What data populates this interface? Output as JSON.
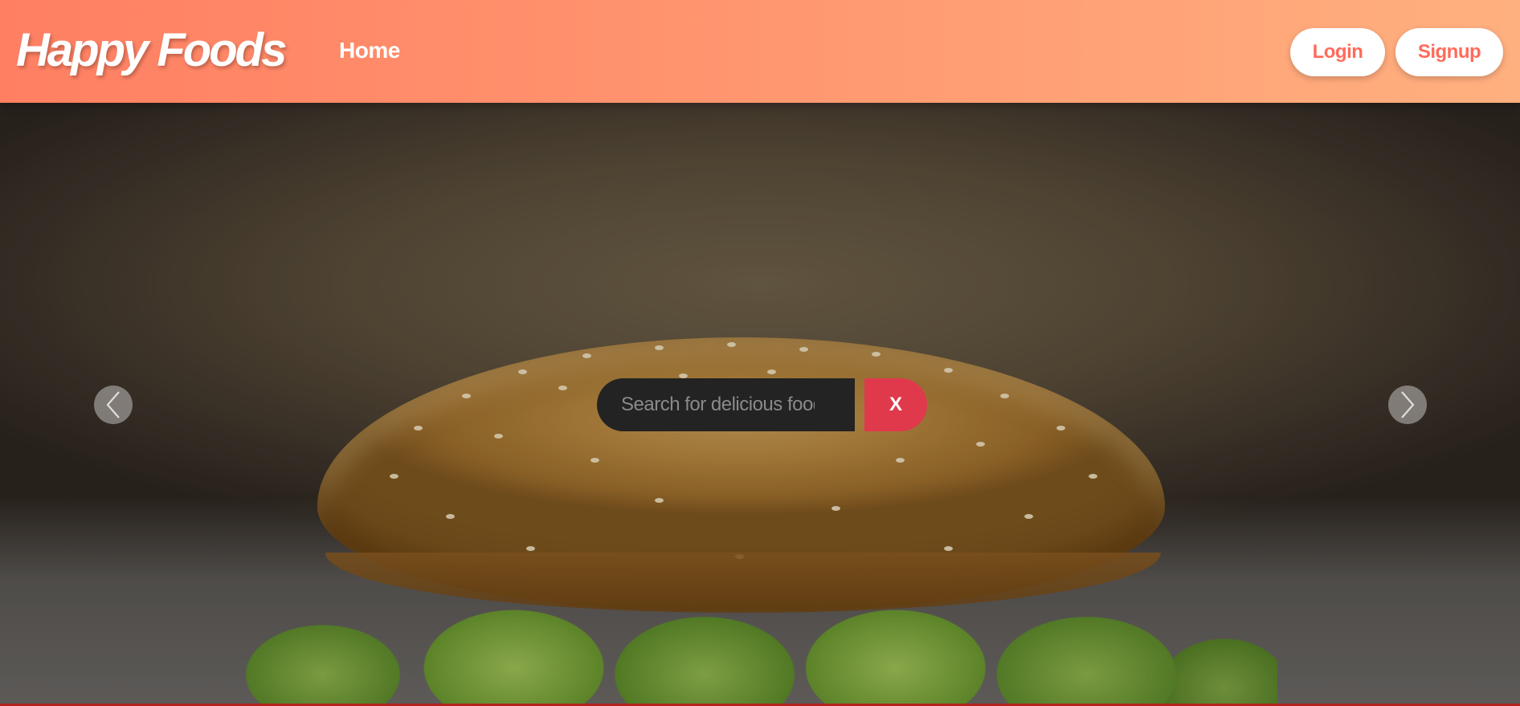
{
  "navbar": {
    "brand": "Happy Foods",
    "home_label": "Home",
    "login_label": "Login",
    "signup_label": "Signup"
  },
  "hero": {
    "search": {
      "placeholder": "Search for delicious food",
      "value": ""
    },
    "clear_label": "X",
    "prev_icon": "chevron-left-icon",
    "next_icon": "chevron-right-icon"
  },
  "colors": {
    "navbar_gradient_start": "#ff7f62",
    "navbar_gradient_end": "#ffb07f",
    "accent": "#ff6b5a",
    "clear_button": "#e0394c",
    "search_bg": "#232323"
  }
}
